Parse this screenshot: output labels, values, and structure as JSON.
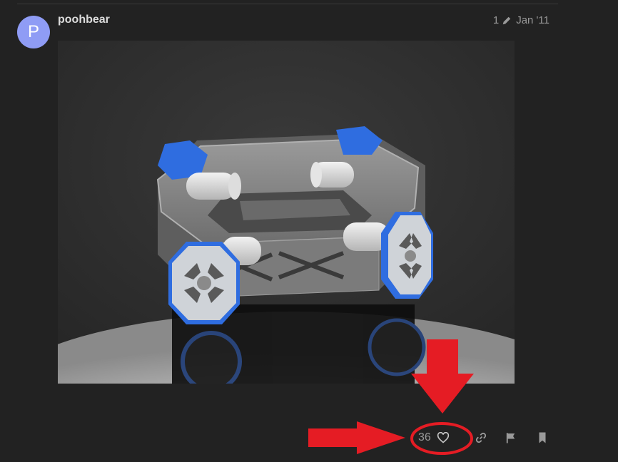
{
  "post": {
    "avatar_letter": "P",
    "username": "poohbear",
    "edit_count": "1",
    "date": "Jan '11"
  },
  "image": {
    "kind": "3D render of an octagonal robot chassis with four omni wheels",
    "colors": {
      "wheel_accent": "#2f6de0",
      "frame": "#8c8c8c",
      "background": "#303030"
    }
  },
  "controls": {
    "like_count": "36",
    "icons": [
      "heart-icon",
      "link-icon",
      "flag-icon",
      "bookmark-icon"
    ]
  },
  "annotation": {
    "color": "#e51c24"
  }
}
